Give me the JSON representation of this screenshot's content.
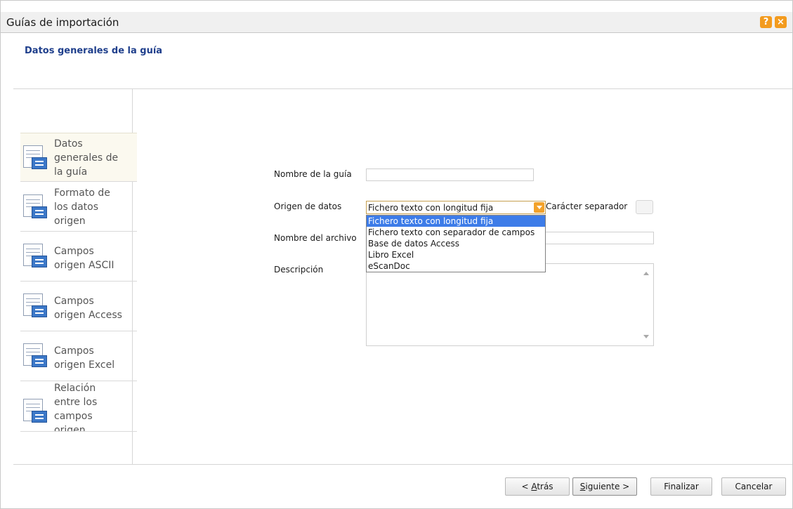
{
  "window": {
    "title": "Guías de importación",
    "help_icon": "help-icon",
    "close_icon": "close-icon"
  },
  "header": {
    "heading": "Datos generales de la guía"
  },
  "sidebar": {
    "items": [
      {
        "icon": "document-list-icon",
        "lines": [
          "Datos",
          "generales de",
          "la guía"
        ],
        "active": true
      },
      {
        "icon": "document-list-icon",
        "lines": [
          "Formato de",
          "los datos",
          "origen"
        ],
        "active": false
      },
      {
        "icon": "document-list-icon",
        "lines": [
          "Campos",
          "origen ASCII"
        ],
        "active": false
      },
      {
        "icon": "document-list-icon",
        "lines": [
          "Campos",
          "origen Access"
        ],
        "active": false
      },
      {
        "icon": "document-list-icon",
        "lines": [
          "Campos",
          "origen Excel"
        ],
        "active": false
      },
      {
        "icon": "document-list-icon",
        "lines": [
          "Relación",
          "entre los",
          "campos",
          "origen..."
        ],
        "active": false
      }
    ]
  },
  "form": {
    "name_label": "Nombre de la guía",
    "name_value": "",
    "source_label": "Origen de datos",
    "source_value": "Fichero texto con longitud fija",
    "source_options": [
      "Fichero texto con longitud fija",
      "Fichero texto con separador de campos",
      "Base de datos Access",
      "Libro Excel",
      "eScanDoc"
    ],
    "separator_label": "Carácter separador",
    "separator_value": "",
    "file_label": "Nombre del archivo",
    "file_value": "",
    "description_label": "Descripción",
    "description_value": ""
  },
  "footer": {
    "back_prefix": "< ",
    "back_key": "A",
    "back_rest": "trás",
    "next_key": "S",
    "next_rest": "iguiente >",
    "finish_label": "Finalizar",
    "cancel_label": "Cancelar"
  },
  "colors": {
    "accent": "#f39b1e",
    "heading": "#1f3f8c",
    "selection": "#3d7ce8"
  }
}
